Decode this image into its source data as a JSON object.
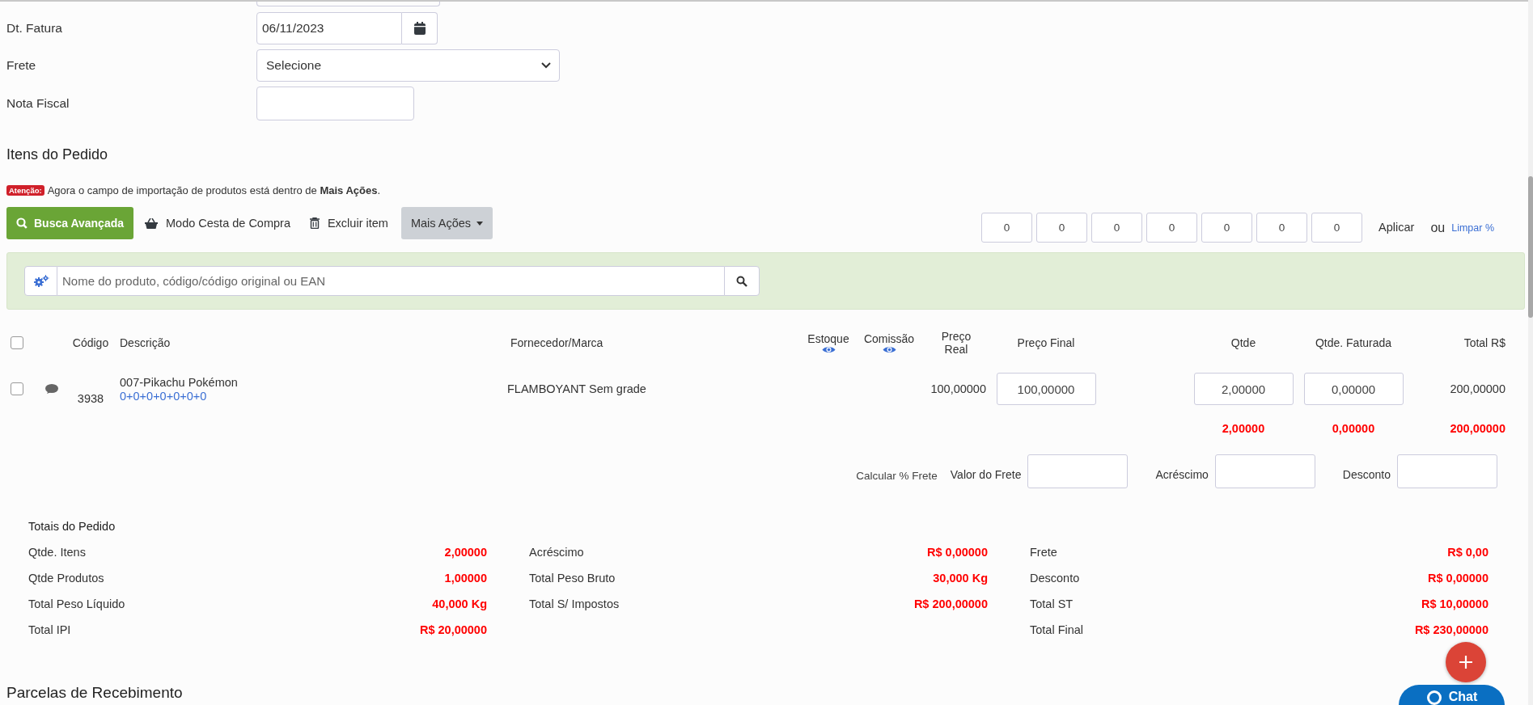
{
  "form_fields": [
    {
      "label": "Dt. Fatura",
      "kind": "date",
      "value": "06/11/2023"
    },
    {
      "label": "Frete",
      "kind": "select",
      "value": "Selecione"
    },
    {
      "label": "Nota Fiscal",
      "kind": "text"
    }
  ],
  "items_section": {
    "title": "Itens do Pedido"
  },
  "notice": {
    "badge": "Atenção:",
    "text": "Agora o campo de importação de produtos está dentro de **Mais Ações**."
  },
  "toolbar": [
    {
      "kind": "primary",
      "label": "Busca Avançada"
    },
    {
      "kind": "basket",
      "label": "Modo Cesta de Compra"
    },
    {
      "kind": "trash",
      "label": "Excluir item"
    },
    {
      "kind": "dropdown",
      "label": "Mais Ações"
    }
  ],
  "percent_inputs": [
    "0",
    "0",
    "0",
    "0",
    "0",
    "0",
    "0"
  ],
  "apply_label": "Aplicar",
  "or_label": "ou",
  "clear_link": "Limpar %",
  "search": {
    "placeholder": "Nome do produto, código/código original ou EAN"
  },
  "table": {
    "select_all": {
      "checked": false
    },
    "columns": [
      {
        "label": "Código"
      },
      {
        "label": "Descrição"
      },
      {
        "label": "Fornecedor/Marca"
      },
      {
        "label": "Estoque",
        "eye": true
      },
      {
        "label": "Comissão",
        "eye": true
      },
      {
        "label": "Preço Real"
      },
      {
        "label": "Preço Final"
      },
      {
        "label": "Qtde"
      },
      {
        "label": "Qtde. Faturada"
      },
      {
        "label": "Total R$"
      }
    ],
    "rows": [
      {
        "checked": false,
        "code": "3938",
        "description": "007-Pikachu Pokémon",
        "grid": "0+0+0+0+0+0+0",
        "supplier": "FLAMBOYANT Sem grade",
        "real_price": "100,00000",
        "final_price": "100,00000",
        "qty": "2,00000",
        "qty_invoiced": "0,00000",
        "total": "200,00000"
      }
    ],
    "sums": {
      "qty": "2,00000",
      "qty_invoiced": "0,00000",
      "total": "200,00000"
    }
  },
  "freight": {
    "calc_label": "Calcular % Frete",
    "fields": [
      {
        "label": "Valor do Frete"
      },
      {
        "label": "Acréscimo"
      },
      {
        "label": "Desconto"
      }
    ]
  },
  "totals": {
    "title": "Totais do Pedido",
    "columns": [
      [
        {
          "label": "Qtde. Itens",
          "value": "2,00000"
        },
        {
          "label": "Qtde Produtos",
          "value": "1,00000"
        },
        {
          "label": "Total Peso Líquido",
          "value": "40,000 Kg"
        },
        {
          "label": "Total IPI",
          "value": "R$ 20,00000"
        }
      ],
      [
        {
          "label": "Acréscimo",
          "value": "R$ 0,00000"
        },
        {
          "label": "Total Peso Bruto",
          "value": "30,000 Kg"
        },
        {
          "label": "Total S/ Impostos",
          "value": "R$ 200,00000"
        }
      ],
      [
        {
          "label": "Frete",
          "value": "R$ 0,00"
        },
        {
          "label": "Desconto",
          "value": "R$ 0,00000"
        },
        {
          "label": "Total ST",
          "value": "R$ 10,00000"
        },
        {
          "label": "Total Final",
          "value": "R$ 230,00000"
        }
      ]
    ]
  },
  "next_section": {
    "title": "Parcelas de Recebimento"
  },
  "chat": {
    "label": "Chat"
  }
}
